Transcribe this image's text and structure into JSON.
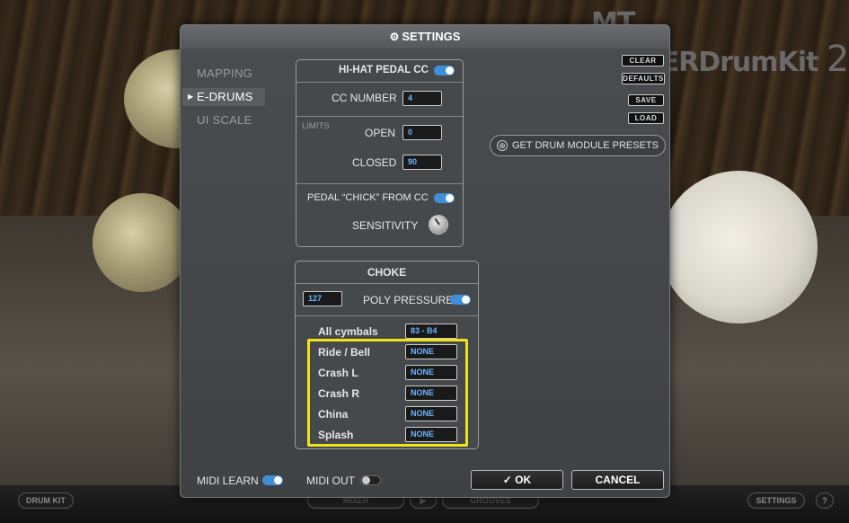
{
  "background": {
    "logo_prefix": "MT",
    "logo_power": "POWER",
    "logo_name": "DrumKit",
    "logo_version": "2",
    "bottom_bar": {
      "drum_kit": "DRUM KIT",
      "mixer": "MIXER",
      "grooves": "GROOVES",
      "settings": "SETTINGS",
      "help": "?"
    }
  },
  "dialog": {
    "title": "SETTINGS",
    "title_icon": "gear-icon",
    "nav": [
      {
        "label": "MAPPING",
        "active": false
      },
      {
        "label": "E-DRUMS",
        "active": true
      },
      {
        "label": "UI SCALE",
        "active": false
      }
    ],
    "hihat": {
      "pedal_cc_label": "HI-HAT PEDAL CC",
      "pedal_cc_enabled": true,
      "cc_number_label": "CC NUMBER",
      "cc_number_value": "4",
      "limits_label": "LIMITS",
      "open_label": "OPEN",
      "open_value": "0",
      "closed_label": "CLOSED",
      "closed_value": "90",
      "chick_label": "PEDAL “CHICK” FROM CC",
      "chick_enabled": true,
      "sensitivity_label": "SENSITIVITY"
    },
    "choke": {
      "title": "CHOKE",
      "value": "127",
      "poly_pressure_label": "POLY PRESSURE",
      "poly_pressure_enabled": true,
      "items": [
        {
          "label": "All  cymbals",
          "value": "83 - B4"
        },
        {
          "label": "Ride / Bell",
          "value": "NONE"
        },
        {
          "label": "Crash L",
          "value": "NONE"
        },
        {
          "label": "Crash R",
          "value": "NONE"
        },
        {
          "label": "China",
          "value": "NONE"
        },
        {
          "label": "Splash",
          "value": "NONE"
        }
      ]
    },
    "side_buttons": {
      "clear": "CLEAR",
      "defaults": "DEFAULTS",
      "save": "SAVE",
      "load": "LOAD"
    },
    "presets_button": "GET DRUM MODULE PRESETS",
    "footer": {
      "midi_learn_label": "MIDI LEARN",
      "midi_learn_enabled": true,
      "midi_out_label": "MIDI OUT",
      "midi_out_enabled": false,
      "ok_label": "✓ OK",
      "cancel_label": "CANCEL"
    },
    "highlight_color": "#f0e41a",
    "accent_color": "#3e8ed8"
  }
}
